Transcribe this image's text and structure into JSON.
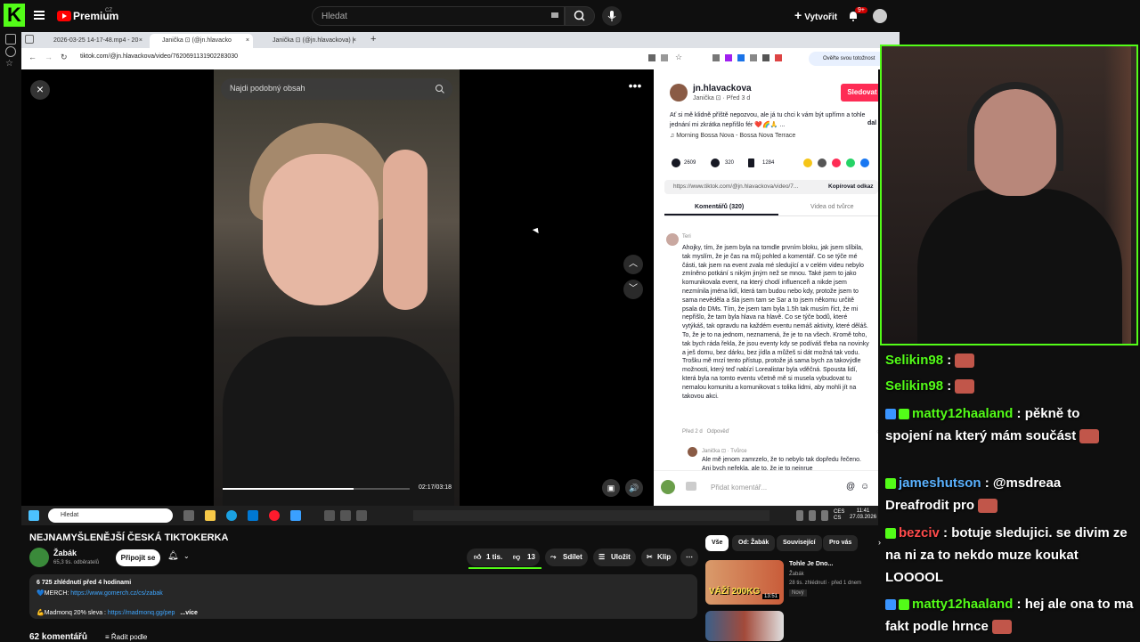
{
  "youtube_header": {
    "logo_letter": "K",
    "premium": "Premium",
    "region": "CZ",
    "search_placeholder": "Hledat",
    "create": "Vytvořit",
    "notif_count": "9+"
  },
  "browser": {
    "tabs": [
      {
        "label": "2026-03-25 14-17-48.mp4 - 20"
      },
      {
        "label": "Janička ⊡ (@jn.hlavacko"
      },
      {
        "label": "Janička ⊡ (@jn.hlavackova) |"
      }
    ],
    "url": "tiktok.com/@jn.hlavackova/video/7620691131902283030",
    "verify": "Ověřte svou totožnost"
  },
  "tiktok": {
    "search_placeholder": "Najdi podobný obsah",
    "time": "02:17/03:18",
    "progress": 0.7,
    "username": "jn.hlavackova",
    "subline": "Janička ⊡ · Před 3 d",
    "follow": "Sledovat",
    "caption": "Ať si mě klidně příště nepozvou, ale já tu chci k vám být upřímn a tohle jednání mi zkrátka nepřišlo fér ❤️🌈🙏 ...",
    "caption_more": "dal",
    "music": "♫ Morning Bossa Nova - Bossa Nova Terrace",
    "likes": "2609",
    "comments": "320",
    "saves": "1284",
    "link": "https://www.tiktok.com/@jn.hlavackova/video/7...",
    "copy_link": "Kopírovat odkaz",
    "tab_comments": "Komentářů (320)",
    "tab_creator": "Videa od tvůrce",
    "comment_author": "Teri",
    "comment_body": "Ahojky, tím, že jsem byla na tomdle prvním bloku, jak jsem slíbila, tak myslím, že je čas na můj pohled a komentář. Co se týče mé části, tak jsem na event zvala mé sledující a v celém videu nebylo zmíněno potkání s nikým jiným než se mnou. Také jsem to jako komunikovala event, na který chodí influenceři a nikde jsem nezmínila jména lidí, která tam budou nebo kdy, protože jsem to sama nevěděla a šla jsem tam se Sar a to jsem někomu určitě psala do DMs. Tím, že jsem tam byla 1.5h tak musím říct, že mi nepřišlo, že tam byla hlava na hlavě. Co se týče bodů, které vytýkáš, tak opravdu na každém eventu nemáš aktivity, které děláš. To, že je to na jednom, neznamená, že je to na všech. Kromě toho, tak bych ráda řekla, že jsou eventy kdy se podíváš třeba na novinky a ješ domu, bez dárku, bez jídla a můžeš si dát možná tak vodu. Trošku mě mrzí tento přístup, protože já sama bych za takovýdle možnosti, který teď nabízí Lorealistar byla vděčná. Spousta lidí, která byla na tomto eventu včetně mě si musela vybudovat tu nemalou komunitu a komunikovat s tolika lidmi, aby mohli jít na takovou akci.",
    "comment_meta": "Před 2 d   Odpověď",
    "reply_author": "Janička ⊡ · Tvůrce",
    "reply_body": "Ale mě jenom zamrzelo, že to nebylo tak dopředu řečeno. Ani bych neřekla, ale to, že je to neinrue",
    "add_comment": "Přidat komentář..."
  },
  "taskbar": {
    "search": "Hledat",
    "time": "11:41",
    "date": "27.03.2026",
    "lang": "CES\nCS"
  },
  "youtube": {
    "title": "NEJNAMYŠLENĚJŠÍ ČESKÁ TIKTOKERKA",
    "channel": "Žabák",
    "subs": "65,3 tis. odběratelů",
    "join": "Připojit se",
    "likes": "1 tis.",
    "dislikes": "13",
    "share": "Sdílet",
    "save": "Uložit",
    "clip": "Klip",
    "views": "6 725 zhlédnutí  před 4 hodinami",
    "merch_label": "💙MERCH: ",
    "merch_link": "https://www.gomerch.cz/cs/zabak",
    "madmonq_label": "💪Madmonq 20% sleva : ",
    "madmonq_link": "https://madmonq.gg/pep",
    "more": "...více",
    "comments_count": "62 komentářů",
    "sort": "Řadit podle",
    "chips": [
      "Vše",
      "Od: Žabák",
      "Související",
      "Pro vás"
    ],
    "rec_title": "Tohle Je Dno...",
    "rec_channel": "Žabák",
    "rec_meta": "28 tis. zhlédnutí · před 1 dnem",
    "rec_new": "Nový",
    "rec_thumb_text": "VÁŽÍ 200KG",
    "rec_duration": "13:51"
  },
  "chat": [
    {
      "user": "Selikin98",
      "text": "",
      "color": "#53fc18"
    },
    {
      "user": "Selikin98",
      "text": "",
      "color": "#53fc18"
    },
    {
      "user": "matty12haaland",
      "text": "pěkně to spojení na který mám součást",
      "color": "#53fc18"
    },
    {
      "user": "jameshutson",
      "text": "@msdreaa Dreafrodit pro",
      "color": "#5ab2ff"
    },
    {
      "user": "bezciv",
      "text": "botuje sledujici. se divim ze na ni za to nekdo muze koukat LOOOOL",
      "color": "#ff4b4b"
    },
    {
      "user": "matty12haaland",
      "text": "hej ale ona to ma fakt podle hrnce",
      "color": "#53fc18"
    }
  ]
}
